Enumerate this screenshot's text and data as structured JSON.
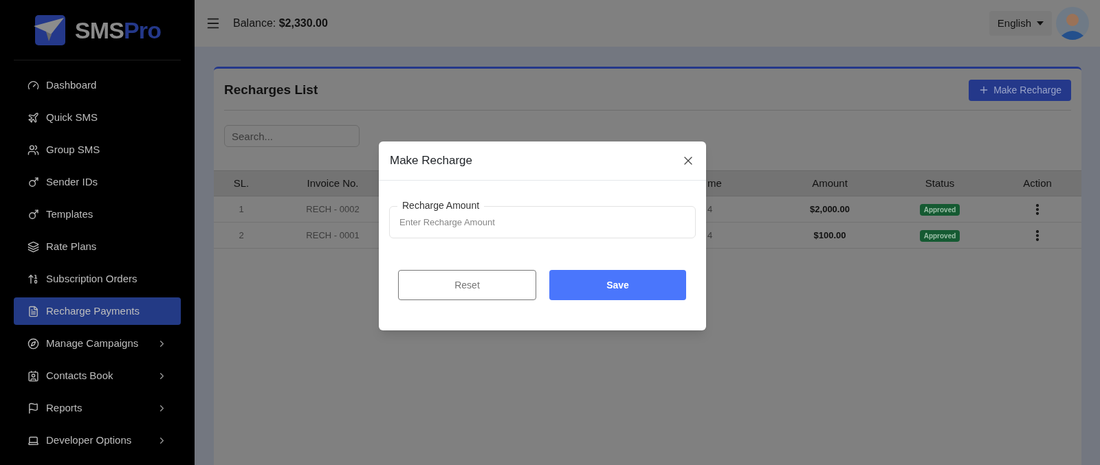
{
  "logo": {
    "text_1": "SMS",
    "text_2": "Pro"
  },
  "sidebar": {
    "items": [
      {
        "label": "Dashboard",
        "selected": false,
        "expandable": false
      },
      {
        "label": "Quick SMS",
        "selected": false,
        "expandable": false
      },
      {
        "label": "Group SMS",
        "selected": false,
        "expandable": false
      },
      {
        "label": "Sender IDs",
        "selected": false,
        "expandable": false
      },
      {
        "label": "Templates",
        "selected": false,
        "expandable": false
      },
      {
        "label": "Rate Plans",
        "selected": false,
        "expandable": false
      },
      {
        "label": "Subscription Orders",
        "selected": false,
        "expandable": false
      },
      {
        "label": "Recharge Payments",
        "selected": true,
        "expandable": false
      },
      {
        "label": "Manage Campaigns",
        "selected": false,
        "expandable": true
      },
      {
        "label": "Contacts Book",
        "selected": false,
        "expandable": true
      },
      {
        "label": "Reports",
        "selected": false,
        "expandable": true
      },
      {
        "label": "Developer Options",
        "selected": false,
        "expandable": true
      }
    ]
  },
  "header": {
    "balance_label": "Balance:",
    "balance_value": "$2,330.00",
    "language": "English"
  },
  "card": {
    "title": "Recharges List",
    "action_button": "Make Recharge",
    "search": {
      "placeholder": "Search..."
    }
  },
  "table": {
    "columns": [
      "SL.",
      "Invoice No.",
      "me",
      "Amount",
      "Status",
      "Action"
    ],
    "rows": [
      {
        "sl": "1",
        "invoice": "RECH - 0002",
        "column_3": "4",
        "amount": "$2,000.00",
        "status": "Approved"
      },
      {
        "sl": "2",
        "invoice": "RECH - 0001",
        "column_3": "4",
        "amount": "$100.00",
        "status": "Approved"
      }
    ]
  },
  "modal": {
    "title": "Make Recharge",
    "field": {
      "label": "Recharge Amount",
      "placeholder": "Enter Recharge Amount"
    },
    "buttons": {
      "reset": "Reset",
      "save": "Save"
    }
  }
}
